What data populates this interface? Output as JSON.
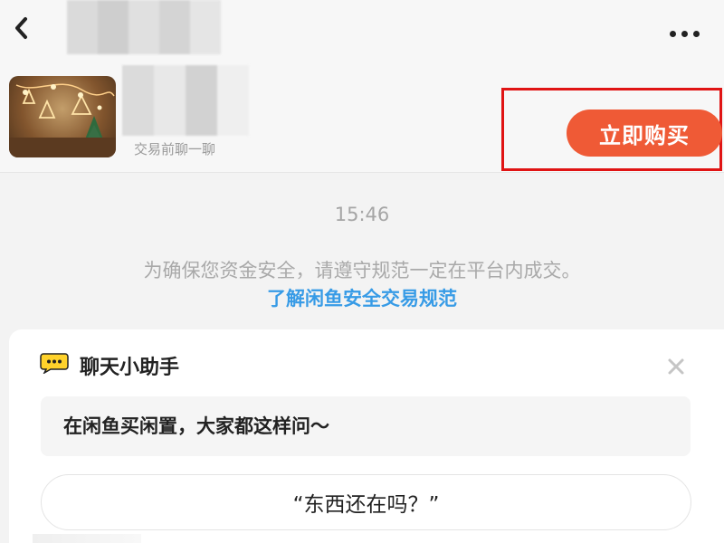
{
  "header": {
    "back_icon": "back-arrow-icon",
    "more_icon": "more-options-icon"
  },
  "product": {
    "image_icon": "product-thumbnail",
    "subtitle": "交易前聊一聊",
    "buy_label": "立即购买"
  },
  "chat": {
    "time": "15:46",
    "notice": "为确保您资金安全，请遵守规范一定在平台内成交。",
    "notice_link": "了解闲鱼安全交易规范"
  },
  "assistant": {
    "icon": "chat-bubble-icon",
    "title": "聊天小助手",
    "close_icon": "close-icon",
    "prompt": "在闲鱼买闲置，大家都这样问～",
    "questions": [
      "“东西还在吗？”"
    ]
  },
  "colors": {
    "buy_button": "#ef5a36",
    "link": "#379be6",
    "highlight_box": "#e01414"
  }
}
